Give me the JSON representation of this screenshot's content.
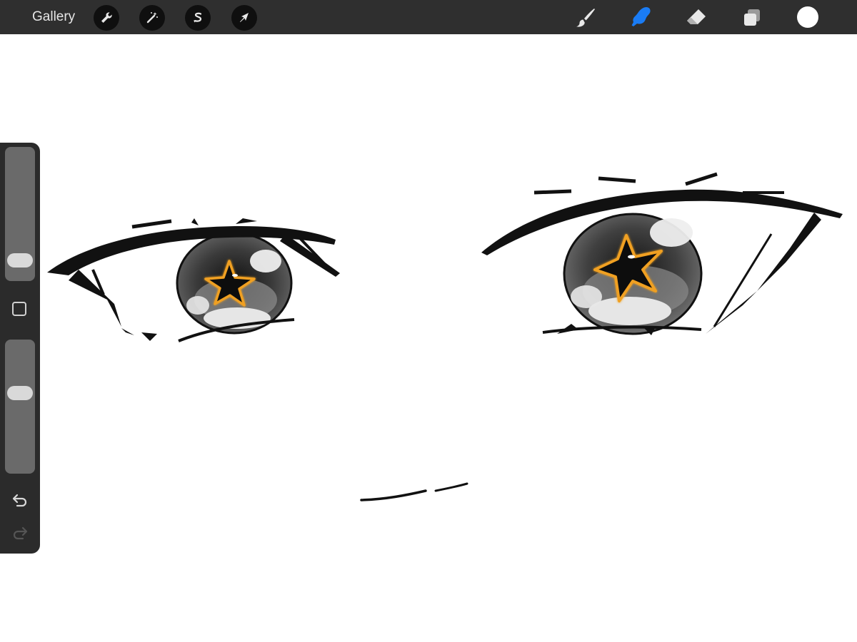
{
  "toolbar": {
    "gallery_label": "Gallery",
    "left_tools": [
      "wrench-icon",
      "magic-wand-icon",
      "selection-icon",
      "transform-arrow-icon"
    ],
    "right_tools": [
      "brush-icon",
      "smudge-icon",
      "eraser-icon",
      "layers-icon"
    ],
    "active_tool": "smudge",
    "active_tool_color": "#1a7cf5",
    "current_color": "#ffffff"
  },
  "sidebar": {
    "brush_size_level": 0.1,
    "opacity_level": 0.62,
    "modify_icon": "square-icon",
    "undo_icon": "undo-arrow-icon",
    "redo_icon": "redo-arrow-icon"
  },
  "artwork": {
    "star_outline_color": "#f0a020"
  }
}
